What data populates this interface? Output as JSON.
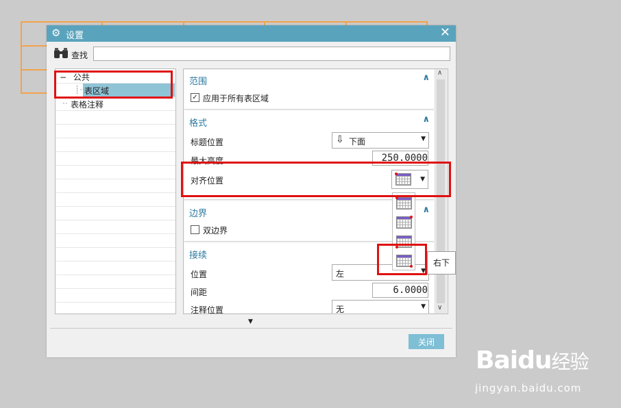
{
  "window": {
    "title": "设置",
    "close_symbol": "✕"
  },
  "find": {
    "label": "查找",
    "value": ""
  },
  "tree": {
    "items": [
      {
        "expander": "−",
        "label": "公共"
      },
      {
        "expander": "",
        "label": "表区域"
      },
      {
        "expander": "",
        "label": "表格注释"
      }
    ]
  },
  "sections": {
    "scope": {
      "title": "范围",
      "checkbox_label": "应用于所有表区域",
      "checked": true
    },
    "format": {
      "title": "格式",
      "title_position_label": "标题位置",
      "title_position_value": "下面",
      "max_height_label": "最大高度",
      "max_height_value": "250.0000",
      "align_label": "对齐位置"
    },
    "border": {
      "title": "边界",
      "checkbox_label": "双边界",
      "checked": false
    },
    "continuation": {
      "title": "接续",
      "position_label": "位置",
      "position_value": "左",
      "spacing_label": "间距",
      "spacing_value": "6.0000",
      "note_position_label": "注释位置",
      "note_position_value": "无"
    }
  },
  "align_dropdown": {
    "options": [
      "左上",
      "右上",
      "左下",
      "右下"
    ],
    "tooltip": "右下"
  },
  "footer": {
    "close_label": "关闭"
  },
  "watermark": {
    "brand": "Baidu",
    "brand_suffix": "经验",
    "url": "jingyan.baidu.com"
  },
  "colors": {
    "titlebar": "#5aa3bc",
    "accent": "#2e7aa0",
    "highlight": "#e01010",
    "orange_table": "#f3a24a"
  }
}
